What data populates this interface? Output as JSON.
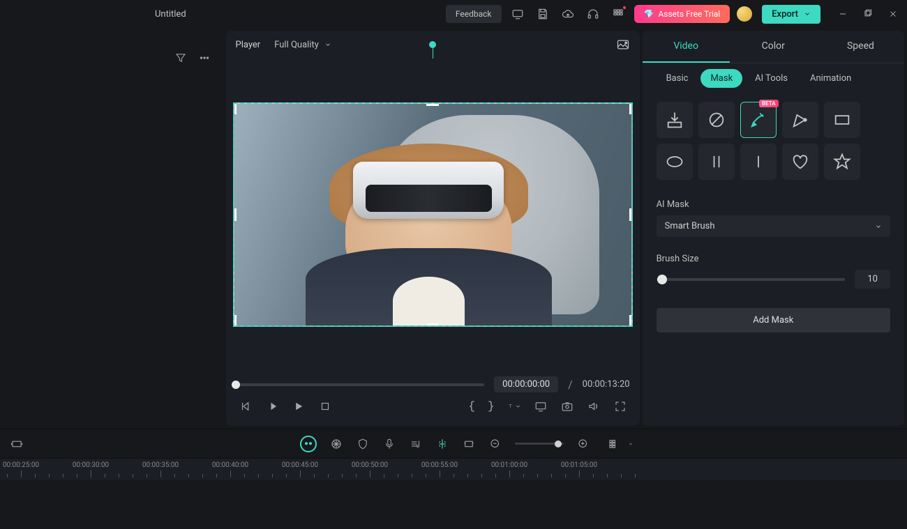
{
  "project": {
    "title": "Untitled"
  },
  "topbar": {
    "feedback": "Feedback",
    "assets_trial": "Assets Free Trial",
    "export": "Export"
  },
  "player": {
    "label": "Player",
    "quality": "Full Quality",
    "current_time": "00:00:00:00",
    "total_time": "00:00:13:20",
    "separator": "/"
  },
  "inspector": {
    "main_tabs": {
      "video": "Video",
      "color": "Color",
      "speed": "Speed"
    },
    "sub_tabs": {
      "basic": "Basic",
      "mask": "Mask",
      "ai_tools": "AI Tools",
      "animation": "Animation"
    },
    "beta": "BETA",
    "ai_mask": {
      "label": "AI Mask",
      "value": "Smart Brush"
    },
    "brush_size": {
      "label": "Brush Size",
      "value": "10"
    },
    "add_mask": "Add Mask"
  },
  "timeline": {
    "labels": [
      "00:00:25:00",
      "00:00:30:00",
      "00:00:35:00",
      "00:00:40:00",
      "00:00:45:00",
      "00:00:50:00",
      "00:00:55:00",
      "00:01:00:00",
      "00:01:05:00"
    ]
  }
}
